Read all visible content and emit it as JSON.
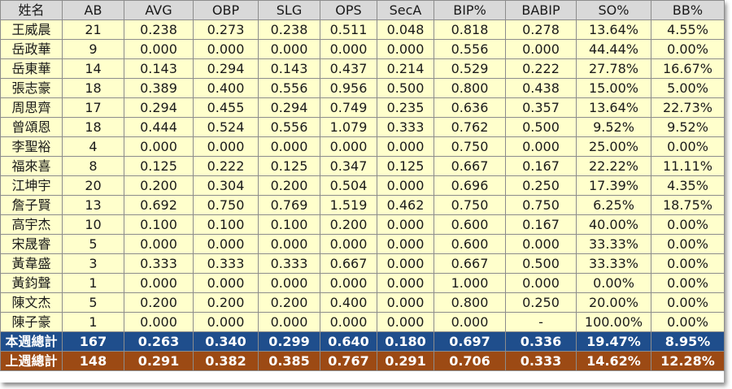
{
  "table": {
    "columns": [
      "姓名",
      "AB",
      "AVG",
      "OBP",
      "SLG",
      "OPS",
      "SecA",
      "BIP%",
      "BABIP",
      "SO%",
      "BB%"
    ],
    "rows": [
      [
        "王威晨",
        "21",
        "0.238",
        "0.273",
        "0.238",
        "0.511",
        "0.048",
        "0.818",
        "0.278",
        "13.64%",
        "4.55%"
      ],
      [
        "岳政華",
        "9",
        "0.000",
        "0.000",
        "0.000",
        "0.000",
        "0.000",
        "0.556",
        "0.000",
        "44.44%",
        "0.00%"
      ],
      [
        "岳東華",
        "14",
        "0.143",
        "0.294",
        "0.143",
        "0.437",
        "0.214",
        "0.529",
        "0.222",
        "27.78%",
        "16.67%"
      ],
      [
        "張志豪",
        "18",
        "0.389",
        "0.400",
        "0.556",
        "0.956",
        "0.500",
        "0.800",
        "0.438",
        "15.00%",
        "5.00%"
      ],
      [
        "周思齊",
        "17",
        "0.294",
        "0.455",
        "0.294",
        "0.749",
        "0.235",
        "0.636",
        "0.357",
        "13.64%",
        "22.73%"
      ],
      [
        "曾頌恩",
        "18",
        "0.444",
        "0.524",
        "0.556",
        "1.079",
        "0.333",
        "0.762",
        "0.500",
        "9.52%",
        "9.52%"
      ],
      [
        "李聖裕",
        "4",
        "0.000",
        "0.000",
        "0.000",
        "0.000",
        "0.000",
        "0.750",
        "0.000",
        "25.00%",
        "0.00%"
      ],
      [
        "福來喜",
        "8",
        "0.125",
        "0.222",
        "0.125",
        "0.347",
        "0.125",
        "0.667",
        "0.167",
        "22.22%",
        "11.11%"
      ],
      [
        "江坤宇",
        "20",
        "0.200",
        "0.304",
        "0.200",
        "0.504",
        "0.000",
        "0.696",
        "0.250",
        "17.39%",
        "4.35%"
      ],
      [
        "詹子賢",
        "13",
        "0.692",
        "0.750",
        "0.769",
        "1.519",
        "0.462",
        "0.750",
        "0.750",
        "6.25%",
        "18.75%"
      ],
      [
        "高宇杰",
        "10",
        "0.100",
        "0.100",
        "0.100",
        "0.200",
        "0.000",
        "0.600",
        "0.167",
        "40.00%",
        "0.00%"
      ],
      [
        "宋晟睿",
        "5",
        "0.000",
        "0.000",
        "0.000",
        "0.000",
        "0.000",
        "0.600",
        "0.000",
        "33.33%",
        "0.00%"
      ],
      [
        "黃韋盛",
        "3",
        "0.333",
        "0.333",
        "0.333",
        "0.667",
        "0.000",
        "0.667",
        "0.500",
        "33.33%",
        "0.00%"
      ],
      [
        "黃鈞聲",
        "1",
        "0.000",
        "0.000",
        "0.000",
        "0.000",
        "0.000",
        "1.000",
        "0.000",
        "0.00%",
        "0.00%"
      ],
      [
        "陳文杰",
        "5",
        "0.200",
        "0.200",
        "0.200",
        "0.400",
        "0.000",
        "0.800",
        "0.250",
        "20.00%",
        "0.00%"
      ],
      [
        "陳子豪",
        "1",
        "0.000",
        "0.000",
        "0.000",
        "0.000",
        "0.000",
        "0.000",
        "-",
        "100.00%",
        "0.00%"
      ]
    ],
    "totals": [
      {
        "color": "#1f4e8c",
        "cells": [
          "本週總計",
          "167",
          "0.263",
          "0.340",
          "0.299",
          "0.640",
          "0.180",
          "0.697",
          "0.336",
          "19.47%",
          "8.95%"
        ]
      },
      {
        "color": "#9c4a14",
        "cells": [
          "上週總計",
          "148",
          "0.291",
          "0.382",
          "0.385",
          "0.767",
          "0.291",
          "0.706",
          "0.333",
          "14.62%",
          "12.28%"
        ]
      }
    ]
  },
  "colors": {
    "header_bg": "#d9d9d9",
    "cell_bg": "#ffffcc",
    "grid": "#8c8c8c"
  }
}
